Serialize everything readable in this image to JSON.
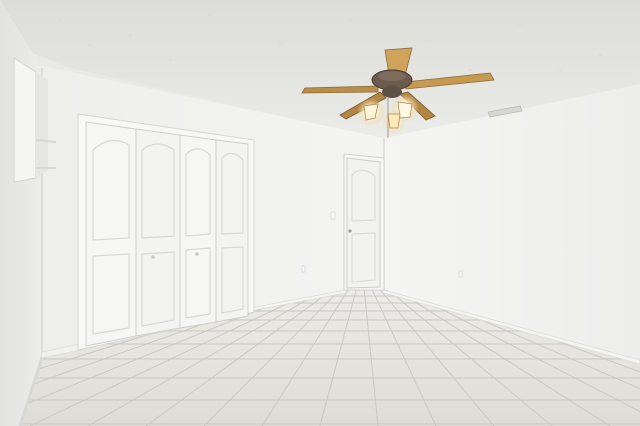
{
  "scene": {
    "subject": "empty-bedroom-interior",
    "features": [
      "ceiling-fan-with-light",
      "bifold-closet-doors",
      "interior-door",
      "tile-floor",
      "wall-shelf",
      "air-vent",
      "textured-ceiling"
    ],
    "colors": {
      "ceiling": "#e6e6e3",
      "wall_left": "#ebebe8",
      "wall_back": "#f2f2ef",
      "wall_right": "#f3f3f1",
      "floor": "#e3e1dc",
      "grout": "#cbc8c1",
      "door": "#f4f4f2",
      "trim": "#f7f7f5",
      "fan_blade": "#c79a52",
      "fan_motor": "#6b5b4e",
      "light_glow": "#fff6d8"
    }
  }
}
